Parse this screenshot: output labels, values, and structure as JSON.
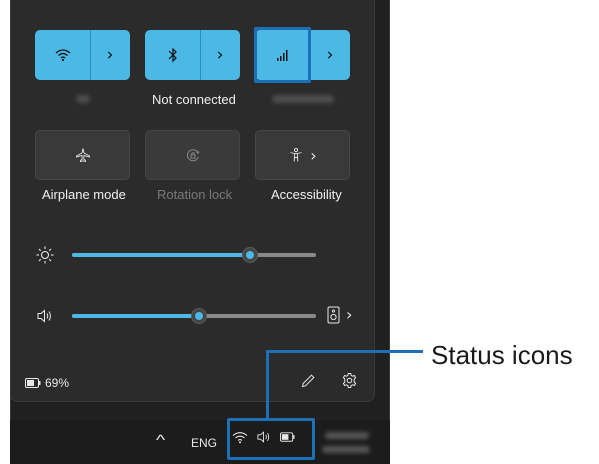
{
  "tiles": {
    "wifi": {
      "icon": "wifi-icon",
      "label": ""
    },
    "bluetooth": {
      "icon": "bluetooth-icon",
      "label": "Not connected"
    },
    "cellular": {
      "icon": "cellular-signal-icon",
      "label": ""
    },
    "airplane": {
      "icon": "airplane-icon",
      "label": "Airplane mode"
    },
    "rotation": {
      "icon": "rotation-lock-icon",
      "label": "Rotation lock"
    },
    "accessibility": {
      "icon": "accessibility-icon",
      "label": "Accessibility"
    }
  },
  "sliders": {
    "brightness": {
      "icon": "brightness-icon",
      "value_fraction": 0.73
    },
    "volume": {
      "icon": "volume-icon",
      "value_fraction": 0.52
    }
  },
  "footer": {
    "battery_percent": "69%",
    "edit_icon": "pencil-icon",
    "settings_icon": "gear-icon"
  },
  "taskbar": {
    "lang": "ENG",
    "caret": "^"
  },
  "callout": {
    "label": "Status icons"
  },
  "colors": {
    "accent": "#4cb8e6",
    "highlight": "#1d6fb8",
    "panel": "#2b2b2b"
  }
}
